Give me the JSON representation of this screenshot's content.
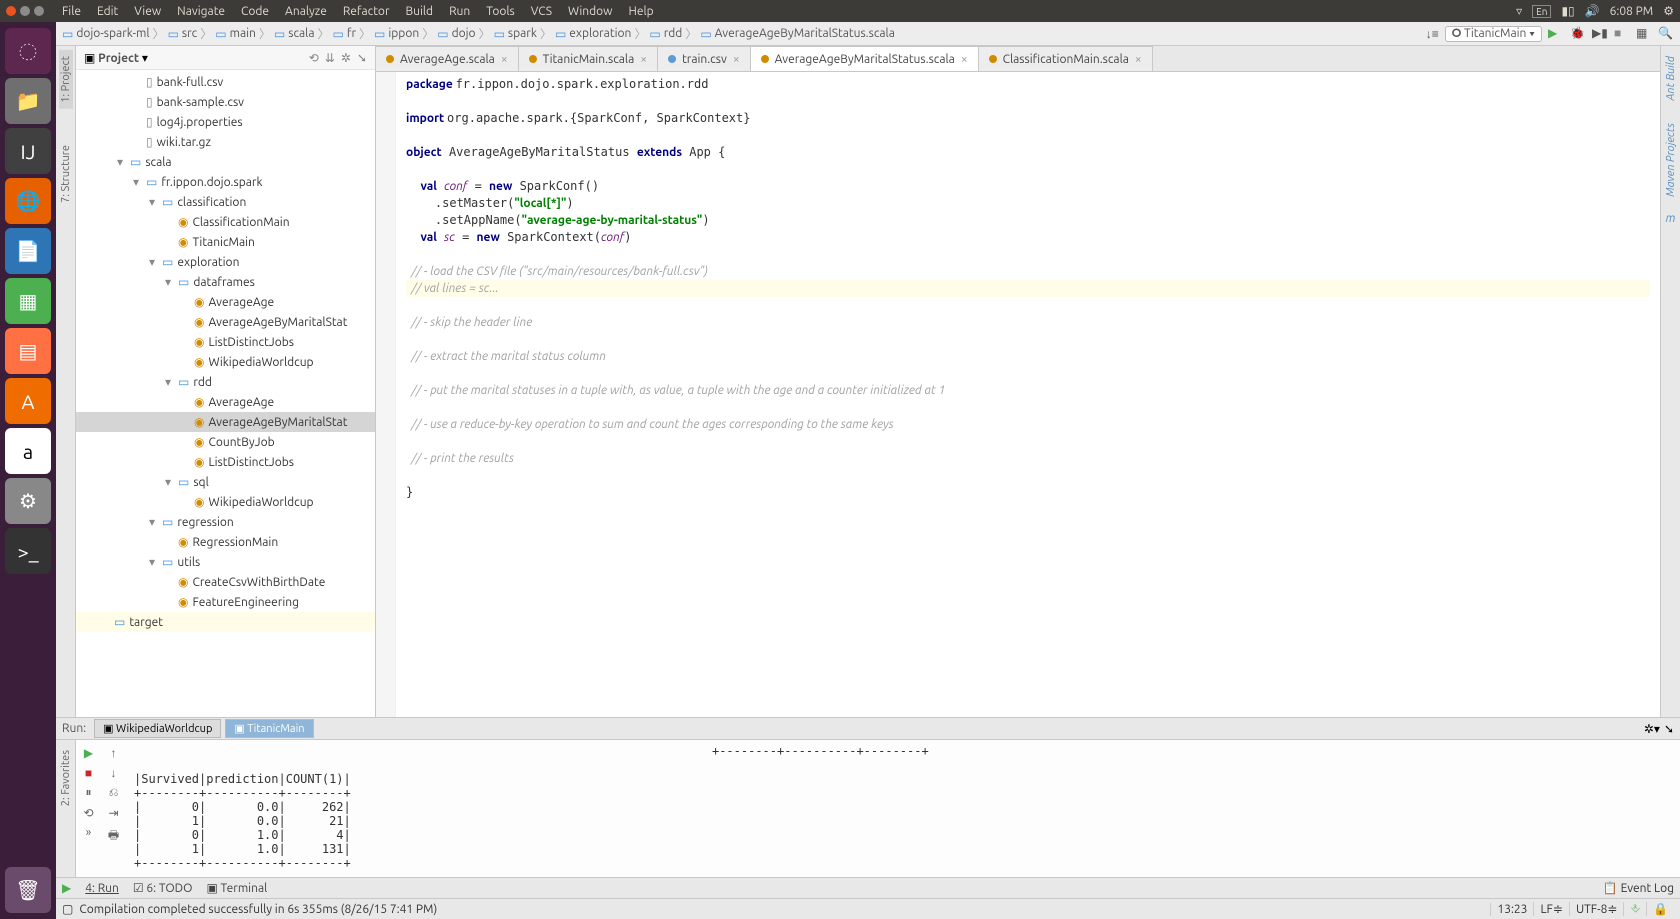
{
  "ubuntu": {
    "menus": [
      "File",
      "Edit",
      "View",
      "Navigate",
      "Code",
      "Analyze",
      "Refactor",
      "Build",
      "Run",
      "Tools",
      "VCS",
      "Window",
      "Help"
    ],
    "lang": "En",
    "time": "6:08 PM"
  },
  "breadcrumb": [
    "dojo-spark-ml",
    "src",
    "main",
    "scala",
    "fr",
    "ippon",
    "dojo",
    "spark",
    "exploration",
    "rdd",
    "AverageAgeByMaritalStatus.scala"
  ],
  "run_config": "TitanicMain",
  "project_panel": {
    "title": "Project"
  },
  "tree": [
    {
      "depth": 3,
      "icon": "file",
      "label": "bank-full.csv"
    },
    {
      "depth": 3,
      "icon": "file",
      "label": "bank-sample.csv"
    },
    {
      "depth": 3,
      "icon": "file",
      "label": "log4j.properties"
    },
    {
      "depth": 3,
      "icon": "file",
      "label": "wiki.tar.gz"
    },
    {
      "depth": 2,
      "tw": "▾",
      "icon": "folder",
      "label": "scala"
    },
    {
      "depth": 3,
      "tw": "▾",
      "icon": "folder",
      "label": "fr.ippon.dojo.spark"
    },
    {
      "depth": 4,
      "tw": "▾",
      "icon": "folder",
      "label": "classification"
    },
    {
      "depth": 5,
      "icon": "obj",
      "label": "ClassificationMain"
    },
    {
      "depth": 5,
      "icon": "obj",
      "label": "TitanicMain"
    },
    {
      "depth": 4,
      "tw": "▾",
      "icon": "folder",
      "label": "exploration"
    },
    {
      "depth": 5,
      "tw": "▾",
      "icon": "folder",
      "label": "dataframes"
    },
    {
      "depth": 6,
      "icon": "obj",
      "label": "AverageAge"
    },
    {
      "depth": 6,
      "icon": "obj",
      "label": "AverageAgeByMaritalStat"
    },
    {
      "depth": 6,
      "icon": "obj",
      "label": "ListDistinctJobs"
    },
    {
      "depth": 6,
      "icon": "obj",
      "label": "WikipediaWorldcup"
    },
    {
      "depth": 5,
      "tw": "▾",
      "icon": "folder",
      "label": "rdd"
    },
    {
      "depth": 6,
      "icon": "obj",
      "label": "AverageAge"
    },
    {
      "depth": 6,
      "icon": "obj",
      "label": "AverageAgeByMaritalStat",
      "sel": true
    },
    {
      "depth": 6,
      "icon": "obj",
      "label": "CountByJob"
    },
    {
      "depth": 6,
      "icon": "obj",
      "label": "ListDistinctJobs"
    },
    {
      "depth": 5,
      "tw": "▾",
      "icon": "folder",
      "label": "sql"
    },
    {
      "depth": 6,
      "icon": "obj",
      "label": "WikipediaWorldcup"
    },
    {
      "depth": 4,
      "tw": "▾",
      "icon": "folder",
      "label": "regression"
    },
    {
      "depth": 5,
      "icon": "obj",
      "label": "RegressionMain"
    },
    {
      "depth": 4,
      "tw": "▾",
      "icon": "folder",
      "label": "utils"
    },
    {
      "depth": 5,
      "icon": "obj",
      "label": "CreateCsvWithBirthDate"
    },
    {
      "depth": 5,
      "icon": "obj",
      "label": "FeatureEngineering"
    },
    {
      "depth": 1,
      "icon": "folder",
      "label": "target",
      "hl": true
    }
  ],
  "editor_tabs": [
    {
      "label": "AverageAge.scala",
      "dot": "orange"
    },
    {
      "label": "TitanicMain.scala",
      "dot": "orange"
    },
    {
      "label": "train.csv",
      "dot": "blue"
    },
    {
      "label": "AverageAgeByMaritalStatus.scala",
      "dot": "orange",
      "active": true
    },
    {
      "label": "ClassificationMain.scala",
      "dot": "orange"
    }
  ],
  "code_lines": [
    {
      "t": "package ",
      "k": "kw",
      "rest": "fr.ippon.dojo.spark.exploration.rdd"
    },
    {
      "blank": true
    },
    {
      "t": "import ",
      "k": "kw",
      "rest": "org.apache.spark.{SparkConf, SparkContext}"
    },
    {
      "blank": true
    },
    {
      "raw": "<span class='kw'>object</span> AverageAgeByMaritalStatus <span class='kw'>extends</span> App {"
    },
    {
      "blank": true
    },
    {
      "raw": "  <span class='kw'>val</span> <span class='ident'>conf</span> = <span class='kw'>new</span> SparkConf()"
    },
    {
      "raw": "    .setMaster(<span class='str'>\"local[*]\"</span>)"
    },
    {
      "raw": "    .setAppName(<span class='str'>\"average-age-by-marital-status\"</span>)"
    },
    {
      "raw": "  <span class='kw'>val</span> <span class='ident'>sc</span> = <span class='kw'>new</span> SparkContext(<span class='ident'>conf</span>)"
    },
    {
      "blank": true
    },
    {
      "cmt": "  // - load the CSV file (\"src/main/resources/bank-full.csv\")"
    },
    {
      "cmt": "  // val lines = sc...",
      "hl": true
    },
    {
      "blank": true
    },
    {
      "cmt": "  // - skip the header line"
    },
    {
      "blank": true
    },
    {
      "cmt": "  // - extract the marital status column"
    },
    {
      "blank": true
    },
    {
      "cmt": "  // - put the marital statuses in a tuple with, as value, a tuple with the age and a counter initialized at 1"
    },
    {
      "blank": true
    },
    {
      "cmt": "  // - use a reduce-by-key operation to sum and count the ages corresponding to the same keys"
    },
    {
      "blank": true
    },
    {
      "cmt": "  // - print the results"
    },
    {
      "blank": true
    },
    {
      "raw": "}"
    }
  ],
  "run_tool": {
    "label": "Run:",
    "tabs": [
      {
        "label": "WikipediaWorldcup"
      },
      {
        "label": "TitanicMain",
        "active": true
      }
    ],
    "output": "                                                                                +--------+----------+--------+\n\n|Survived|prediction|COUNT(1)|\n+--------+----------+--------+\n|       0|       0.0|     262|\n|       1|       0.0|      21|\n|       0|       1.0|       4|\n|       1|       1.0|     131|\n+--------+----------+--------+"
  },
  "bottom_strip": {
    "run": "4: Run",
    "todo": "6: TODO",
    "terminal": "Terminal",
    "event_log": "Event Log"
  },
  "status": {
    "msg": "Compilation completed successfully in 6s 355ms (8/26/15 7:41 PM)",
    "pos": "13:23",
    "sep": "LF≑",
    "enc": "UTF-8≑"
  },
  "side_tabs": {
    "project": "1: Project",
    "structure": "7: Structure",
    "favorites": "2: Favorites",
    "ant": "Ant Build",
    "maven": "Maven Projects",
    "m": "m"
  }
}
